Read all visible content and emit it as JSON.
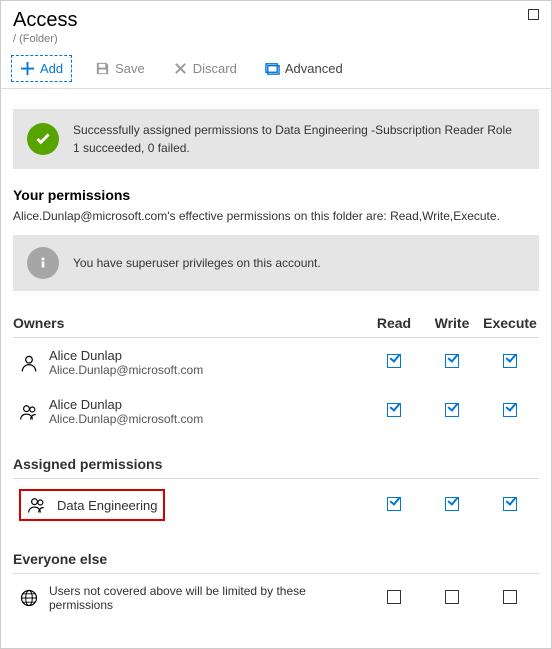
{
  "header": {
    "title": "Access",
    "breadcrumb": "/ (Folder)"
  },
  "toolbar": {
    "add": "Add",
    "save": "Save",
    "discard": "Discard",
    "advanced": "Advanced"
  },
  "success": {
    "line1": "Successfully assigned permissions to Data Engineering -Subscription Reader Role",
    "line2": "1 succeeded, 0 failed."
  },
  "yourPermissions": {
    "title": "Your permissions",
    "text": "Alice.Dunlap@microsoft.com's effective permissions on this folder are: Read,Write,Execute."
  },
  "superuser": "You have superuser privileges on this account.",
  "columns": {
    "name": "",
    "read": "Read",
    "write": "Write",
    "execute": "Execute"
  },
  "owners": {
    "title": "Owners",
    "rows": [
      {
        "name": "Alice Dunlap",
        "email": "Alice.Dunlap@microsoft.com",
        "icon": "person",
        "read": true,
        "write": true,
        "execute": true
      },
      {
        "name": "Alice Dunlap",
        "email": "Alice.Dunlap@microsoft.com",
        "icon": "group",
        "read": true,
        "write": true,
        "execute": true
      }
    ]
  },
  "assigned": {
    "title": "Assigned permissions",
    "rows": [
      {
        "name": "Data Engineering",
        "icon": "group",
        "highlight": true,
        "read": true,
        "write": true,
        "execute": true
      }
    ]
  },
  "everyone": {
    "title": "Everyone else",
    "text": "Users not covered above will be limited by these permissions",
    "read": false,
    "write": false,
    "execute": false
  }
}
